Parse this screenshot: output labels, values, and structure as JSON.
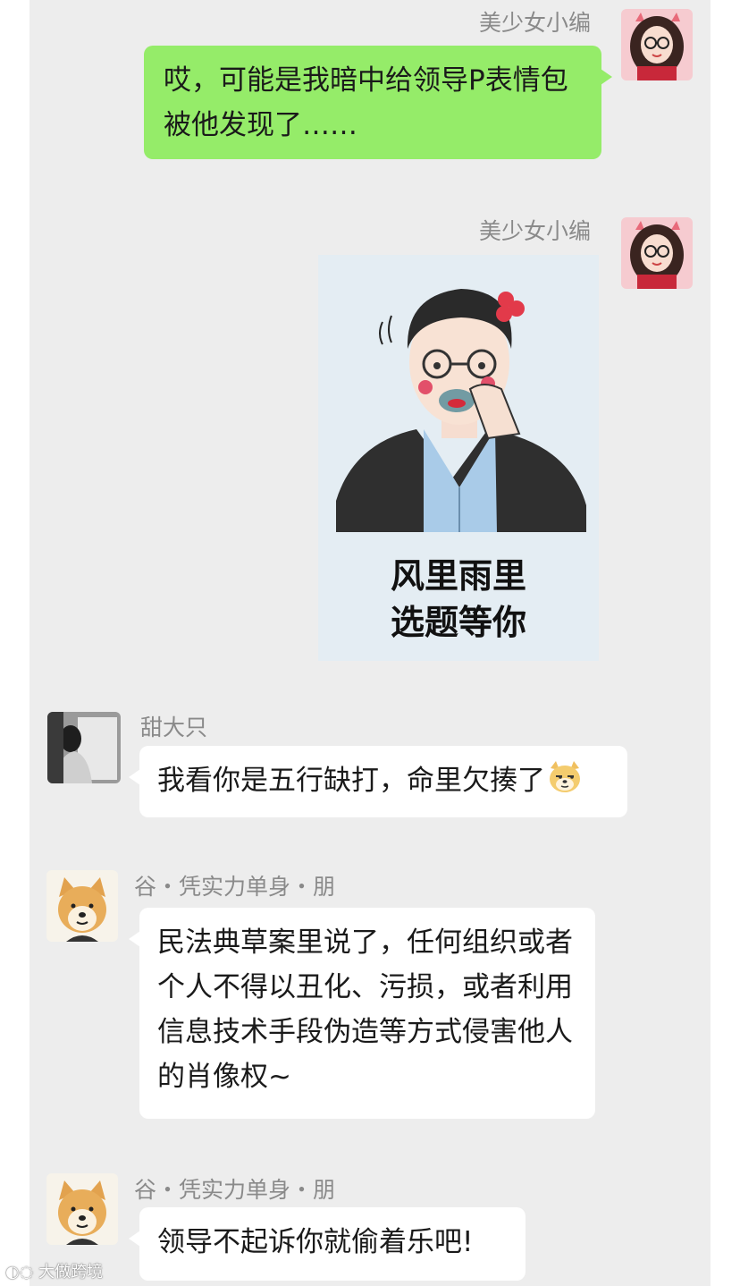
{
  "messages": [
    {
      "sender": "美少女小编",
      "text": "哎，可能是我暗中给领导P表情包被他发现了……"
    },
    {
      "sender": "美少女小编",
      "sticker": {
        "line1": "风里雨里",
        "line2": "选题等你"
      }
    },
    {
      "sender": "甜大只",
      "text": "我看你是五行缺打，命里欠揍了",
      "emoji": "doge-emoji"
    },
    {
      "sender": "谷・凭实力单身・朋",
      "text": "民法典草案里说了，任何组织或者个人不得以丑化、污损，或者利用信息技术手段伪造等方式侵害他人的肖像权~"
    },
    {
      "sender": "谷・凭实力单身・朋",
      "text": "领导不起诉你就偷着乐吧!"
    }
  ],
  "watermark": "大做跨境",
  "colors": {
    "chat_bg": "#ededed",
    "green_bubble": "#95ec69",
    "white_bubble": "#ffffff",
    "sticker_bg": "#e4edf3"
  }
}
